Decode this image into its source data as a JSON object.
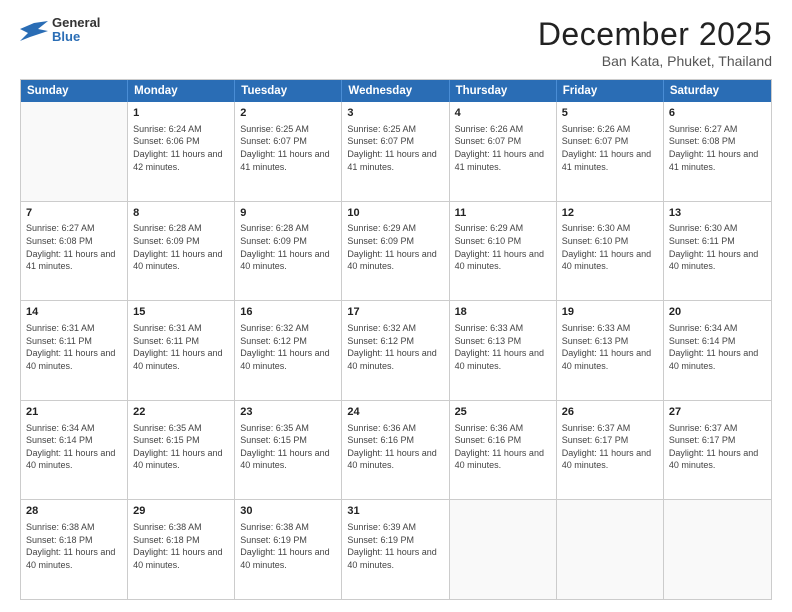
{
  "logo": {
    "general": "General",
    "blue": "Blue"
  },
  "title": "December 2025",
  "location": "Ban Kata, Phuket, Thailand",
  "days_of_week": [
    "Sunday",
    "Monday",
    "Tuesday",
    "Wednesday",
    "Thursday",
    "Friday",
    "Saturday"
  ],
  "weeks": [
    [
      {
        "day": "",
        "empty": true
      },
      {
        "day": "1",
        "sunrise": "6:24 AM",
        "sunset": "6:06 PM",
        "daylight": "11 hours and 42 minutes."
      },
      {
        "day": "2",
        "sunrise": "6:25 AM",
        "sunset": "6:07 PM",
        "daylight": "11 hours and 41 minutes."
      },
      {
        "day": "3",
        "sunrise": "6:25 AM",
        "sunset": "6:07 PM",
        "daylight": "11 hours and 41 minutes."
      },
      {
        "day": "4",
        "sunrise": "6:26 AM",
        "sunset": "6:07 PM",
        "daylight": "11 hours and 41 minutes."
      },
      {
        "day": "5",
        "sunrise": "6:26 AM",
        "sunset": "6:07 PM",
        "daylight": "11 hours and 41 minutes."
      },
      {
        "day": "6",
        "sunrise": "6:27 AM",
        "sunset": "6:08 PM",
        "daylight": "11 hours and 41 minutes."
      }
    ],
    [
      {
        "day": "7",
        "sunrise": "6:27 AM",
        "sunset": "6:08 PM",
        "daylight": "11 hours and 41 minutes."
      },
      {
        "day": "8",
        "sunrise": "6:28 AM",
        "sunset": "6:09 PM",
        "daylight": "11 hours and 40 minutes."
      },
      {
        "day": "9",
        "sunrise": "6:28 AM",
        "sunset": "6:09 PM",
        "daylight": "11 hours and 40 minutes."
      },
      {
        "day": "10",
        "sunrise": "6:29 AM",
        "sunset": "6:09 PM",
        "daylight": "11 hours and 40 minutes."
      },
      {
        "day": "11",
        "sunrise": "6:29 AM",
        "sunset": "6:10 PM",
        "daylight": "11 hours and 40 minutes."
      },
      {
        "day": "12",
        "sunrise": "6:30 AM",
        "sunset": "6:10 PM",
        "daylight": "11 hours and 40 minutes."
      },
      {
        "day": "13",
        "sunrise": "6:30 AM",
        "sunset": "6:11 PM",
        "daylight": "11 hours and 40 minutes."
      }
    ],
    [
      {
        "day": "14",
        "sunrise": "6:31 AM",
        "sunset": "6:11 PM",
        "daylight": "11 hours and 40 minutes."
      },
      {
        "day": "15",
        "sunrise": "6:31 AM",
        "sunset": "6:11 PM",
        "daylight": "11 hours and 40 minutes."
      },
      {
        "day": "16",
        "sunrise": "6:32 AM",
        "sunset": "6:12 PM",
        "daylight": "11 hours and 40 minutes."
      },
      {
        "day": "17",
        "sunrise": "6:32 AM",
        "sunset": "6:12 PM",
        "daylight": "11 hours and 40 minutes."
      },
      {
        "day": "18",
        "sunrise": "6:33 AM",
        "sunset": "6:13 PM",
        "daylight": "11 hours and 40 minutes."
      },
      {
        "day": "19",
        "sunrise": "6:33 AM",
        "sunset": "6:13 PM",
        "daylight": "11 hours and 40 minutes."
      },
      {
        "day": "20",
        "sunrise": "6:34 AM",
        "sunset": "6:14 PM",
        "daylight": "11 hours and 40 minutes."
      }
    ],
    [
      {
        "day": "21",
        "sunrise": "6:34 AM",
        "sunset": "6:14 PM",
        "daylight": "11 hours and 40 minutes."
      },
      {
        "day": "22",
        "sunrise": "6:35 AM",
        "sunset": "6:15 PM",
        "daylight": "11 hours and 40 minutes."
      },
      {
        "day": "23",
        "sunrise": "6:35 AM",
        "sunset": "6:15 PM",
        "daylight": "11 hours and 40 minutes."
      },
      {
        "day": "24",
        "sunrise": "6:36 AM",
        "sunset": "6:16 PM",
        "daylight": "11 hours and 40 minutes."
      },
      {
        "day": "25",
        "sunrise": "6:36 AM",
        "sunset": "6:16 PM",
        "daylight": "11 hours and 40 minutes."
      },
      {
        "day": "26",
        "sunrise": "6:37 AM",
        "sunset": "6:17 PM",
        "daylight": "11 hours and 40 minutes."
      },
      {
        "day": "27",
        "sunrise": "6:37 AM",
        "sunset": "6:17 PM",
        "daylight": "11 hours and 40 minutes."
      }
    ],
    [
      {
        "day": "28",
        "sunrise": "6:38 AM",
        "sunset": "6:18 PM",
        "daylight": "11 hours and 40 minutes."
      },
      {
        "day": "29",
        "sunrise": "6:38 AM",
        "sunset": "6:18 PM",
        "daylight": "11 hours and 40 minutes."
      },
      {
        "day": "30",
        "sunrise": "6:38 AM",
        "sunset": "6:19 PM",
        "daylight": "11 hours and 40 minutes."
      },
      {
        "day": "31",
        "sunrise": "6:39 AM",
        "sunset": "6:19 PM",
        "daylight": "11 hours and 40 minutes."
      },
      {
        "day": "",
        "empty": true
      },
      {
        "day": "",
        "empty": true
      },
      {
        "day": "",
        "empty": true
      }
    ]
  ]
}
